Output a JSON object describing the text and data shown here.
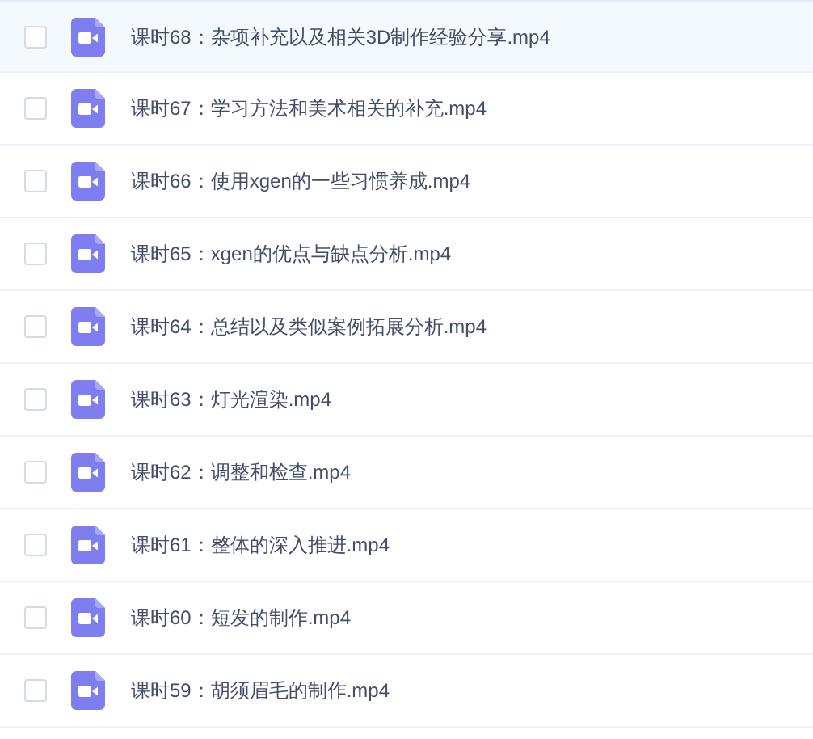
{
  "files": [
    {
      "name": "课时68：杂项补充以及相关3D制作经验分享.mp4",
      "highlighted": true,
      "checked": false
    },
    {
      "name": "课时67：学习方法和美术相关的补充.mp4",
      "highlighted": false,
      "checked": false
    },
    {
      "name": "课时66：使用xgen的一些习惯养成.mp4",
      "highlighted": false,
      "checked": false
    },
    {
      "name": "课时65：xgen的优点与缺点分析.mp4",
      "highlighted": false,
      "checked": false
    },
    {
      "name": "课时64：总结以及类似案例拓展分析.mp4",
      "highlighted": false,
      "checked": false
    },
    {
      "name": "课时63：灯光渲染.mp4",
      "highlighted": false,
      "checked": false
    },
    {
      "name": "课时62：调整和检查.mp4",
      "highlighted": false,
      "checked": false
    },
    {
      "name": "课时61：整体的深入推进.mp4",
      "highlighted": false,
      "checked": false
    },
    {
      "name": "课时60：短发的制作.mp4",
      "highlighted": false,
      "checked": false
    },
    {
      "name": "课时59：胡须眉毛的制作.mp4",
      "highlighted": false,
      "checked": false
    }
  ]
}
